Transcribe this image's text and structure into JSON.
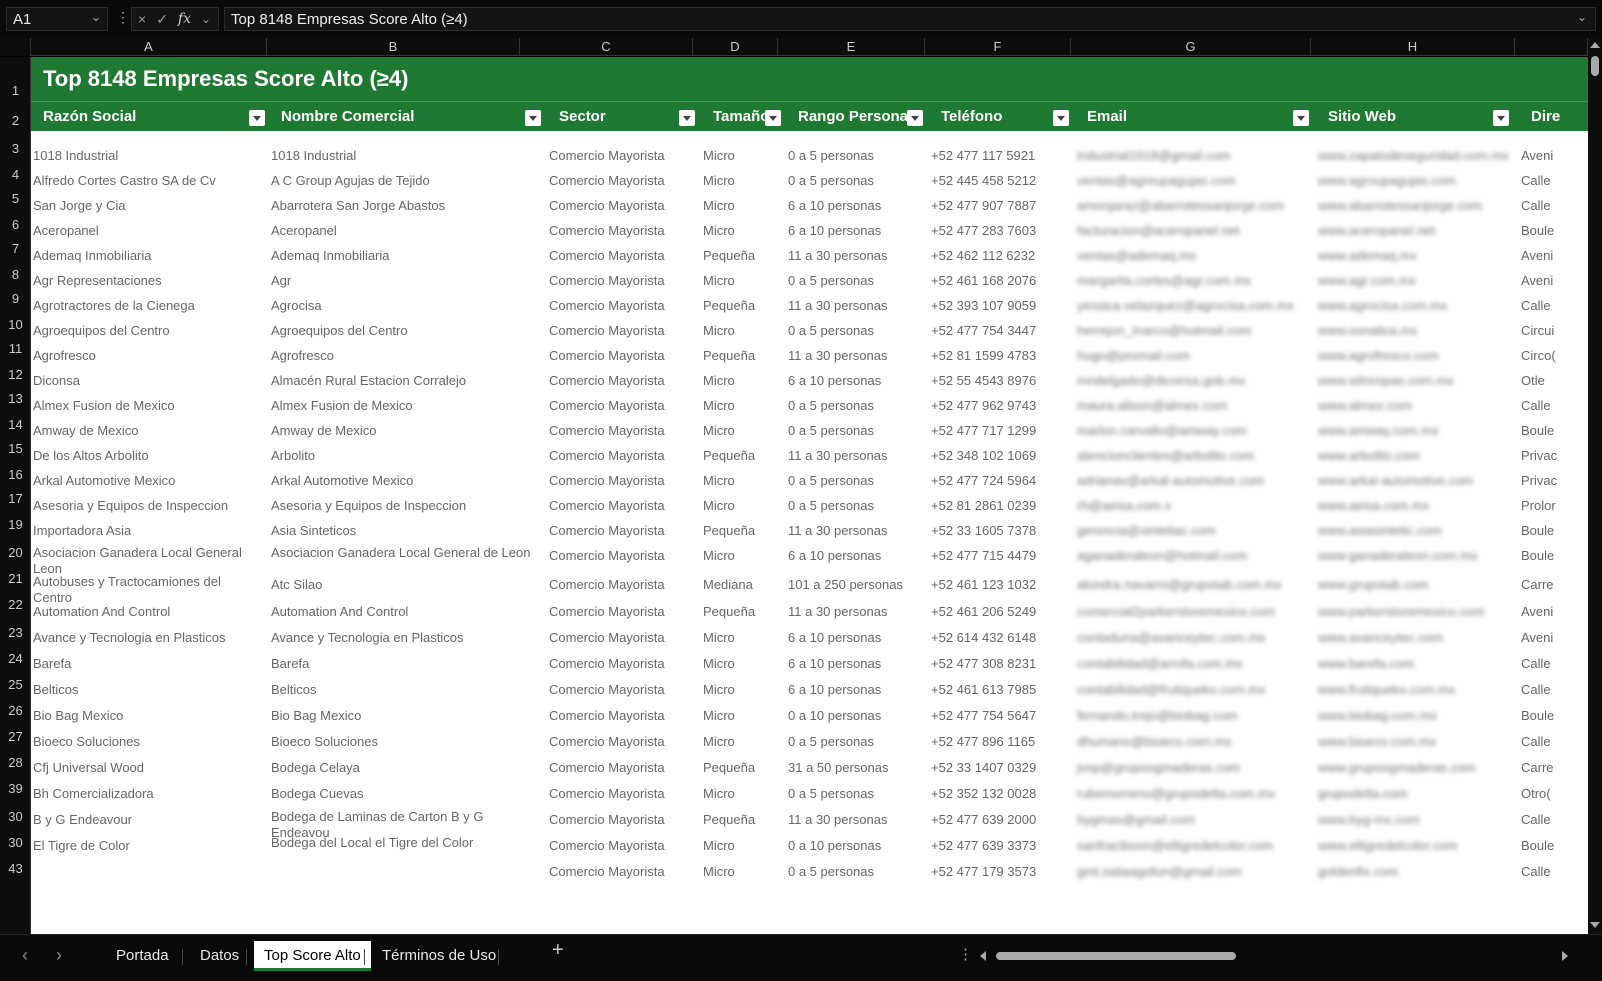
{
  "formula_bar": {
    "cell_ref": "A1",
    "cancel_icon": "×",
    "enter_icon": "✓",
    "fx_label": "fx",
    "formula": "Top 8148 Empresas Score Alto (≥4)"
  },
  "columns": [
    "A",
    "B",
    "C",
    "D",
    "E",
    "F",
    "G",
    "H"
  ],
  "row_numbers": [
    "1",
    "2",
    "3",
    "4",
    "5",
    "6",
    "7",
    "8",
    "9",
    "10",
    "11",
    "12",
    "13",
    "14",
    "15",
    "16",
    "17",
    "19",
    "20",
    "21",
    "22",
    "23",
    "24",
    "25",
    "26",
    "27",
    "28",
    "39",
    "30",
    "30",
    "43"
  ],
  "sheet": {
    "title": "Top 8148 Empresas Score Alto (≥4)",
    "headers": [
      "Razón Social",
      "Nombre Comercial",
      "Sector",
      "Tamaño",
      "Rango Personal",
      "Teléfono",
      "Email",
      "Sitio Web",
      "Dire"
    ],
    "rows": [
      [
        "1018 Industrial",
        "1018 Industrial",
        "Comercio Mayorista",
        "Micro",
        "0 a 5 personas",
        "+52 477 117 5921",
        "industrial1018@gmail.com",
        "www.zapatodeseguridad.com.mx",
        "Aveni"
      ],
      [
        "Alfredo Cortes Castro SA de Cv",
        "A C Group Agujas de Tejido",
        "Comercio Mayorista",
        "Micro",
        "0 a 5 personas",
        "+52 445 458 5212",
        "ventas@agroupagujas.com",
        "www.agroupagujas.com",
        "Calle"
      ],
      [
        "San Jorge y Cia",
        "Abarrotera San Jorge Abastos",
        "Comercio Mayorista",
        "Micro",
        "6 a 10 personas",
        "+52 477 907 7887",
        "amonjaraz@abarrotessanjorge.com",
        "www.abarrotessanjorge.com",
        "Calle"
      ],
      [
        "Aceropanel",
        "Aceropanel",
        "Comercio Mayorista",
        "Micro",
        "6 a 10 personas",
        "+52 477 283 7603",
        "facturacion@aceropanel.net",
        "www.aceropanel.net",
        "Boule"
      ],
      [
        "Ademaq Inmobiliaria",
        "Ademaq Inmobiliaria",
        "Comercio Mayorista",
        "Pequeña",
        "11 a 30 personas",
        "+52 462 112 6232",
        "ventas@ademaq.mx",
        "www.ademaq.mx",
        "Aveni"
      ],
      [
        "Agr Representaciones",
        "Agr",
        "Comercio Mayorista",
        "Micro",
        "0 a 5 personas",
        "+52 461 168 2076",
        "margarita.cortes@agr.com.mx",
        "www.agr.com.mx",
        "Aveni"
      ],
      [
        "Agrotractores de la Cienega",
        "Agrocisa",
        "Comercio Mayorista",
        "Pequeña",
        "11 a 30 personas",
        "+52 393 107 9059",
        "yessica.velazquez@agrocisa.com.mx",
        "www.agrocisa.com.mx",
        "Calle"
      ],
      [
        "Agroequipos del Centro",
        "Agroequipos del Centro",
        "Comercio Mayorista",
        "Micro",
        "0 a 5 personas",
        "+52 477 754 3447",
        "herrejon_marco@hotmail.com",
        "www.sonalica.mx",
        "Circui"
      ],
      [
        "Agrofresco",
        "Agrofresco",
        "Comercio Mayorista",
        "Pequeña",
        "11 a 30 personas",
        "+52 81 1599 4783",
        "hugo@promail.com",
        "www.agrofresco.com",
        "Circo("
      ],
      [
        "Diconsa",
        "Almacén Rural Estacion Corralejo",
        "Comercio Mayorista",
        "Micro",
        "6 a 10 personas",
        "+52 55 4543 8976",
        "mndelgado@diconsa.gob.mx",
        "www.wlmropas.com.mx",
        "Otle"
      ],
      [
        "Almex Fusion de Mexico",
        "Almex Fusion de Mexico",
        "Comercio Mayorista",
        "Micro",
        "0 a 5 personas",
        "+52 477 962 9743",
        "maura.alison@almex.com",
        "www.almex.com",
        "Calle"
      ],
      [
        "Amway de Mexico",
        "Amway de Mexico",
        "Comercio Mayorista",
        "Micro",
        "0 a 5 personas",
        "+52 477 717 1299",
        "marlon.carvallo@amway.com",
        "www.amway.com.mx",
        "Boule"
      ],
      [
        "De los Altos Arbolito",
        "Arbolito",
        "Comercio Mayorista",
        "Pequeña",
        "11 a 30 personas",
        "+52 348 102 1069",
        "atencionclientes@arbolito.com",
        "www.arbolito.com",
        "Privac"
      ],
      [
        "Arkal Automotive Mexico",
        "Arkal Automotive Mexico",
        "Comercio Mayorista",
        "Micro",
        "0 a 5 personas",
        "+52 477 724 5964",
        "adrianav@arkal-automotive.com",
        "www.arkal-automotive.com",
        "Privac"
      ],
      [
        "Asesoria y Equipos de Inspeccion",
        "Asesoria y Equipos de Inspeccion",
        "Comercio Mayorista",
        "Micro",
        "0 a 5 personas",
        "+52 81 2861 0239",
        "rh@aeisa.com.x",
        "www.aeisa.com.mx",
        "Prolor"
      ],
      [
        "Importadora Asia",
        "Asia Sinteticos",
        "Comercio Mayorista",
        "Pequeña",
        "11 a 30 personas",
        "+52 33 1605 7378",
        "gerencia@sintetiac.com",
        "www.asiasintetic.com",
        "Boule"
      ],
      [
        "Asociacion Ganadera Local General Leon",
        "Asociacion Ganadera Local General de Leon",
        "Comercio Mayorista",
        "Micro",
        "6 a 10 personas",
        "+52 477 715 4479",
        "aganaderaleon@hotmail.com",
        "www.ganaderaleon.com.mx",
        "Boule"
      ],
      [
        "Autobuses y Tractocamiones del Centro",
        "Atc Silao",
        "Comercio Mayorista",
        "Mediana",
        "101 a 250 personas",
        "+52 461 123 1032",
        "alondra.navarro@grupotab.com.mx",
        "www.grupotab.com",
        "Carre"
      ],
      [
        "Automation And Control",
        "Automation And Control",
        "Comercio Mayorista",
        "Pequeña",
        "11 a 30 personas",
        "+52 461 206 5249",
        "comercial2parkerstoremexico.com",
        "www.parkerstoremexico.com",
        "Aveni"
      ],
      [
        "Avance y Tecnologia en Plasticos",
        "Avance y Tecnologia en Plasticos",
        "Comercio Mayorista",
        "Micro",
        "6 a 10 personas",
        "+52 614 432 6148",
        "contaduria@avanceytec.com.mx",
        "www.avanceytec.com",
        "Aveni"
      ],
      [
        "Barefa",
        "Barefa",
        "Comercio Mayorista",
        "Micro",
        "6 a 10 personas",
        "+52 477 308 8231",
        "contabilidad@arrofa.com.mx",
        "www.barefa.com",
        "Calle"
      ],
      [
        "Belticos",
        "Belticos",
        "Comercio Mayorista",
        "Micro",
        "6 a 10 personas",
        "+52 461 613 7985",
        "contabilidad@frutiqueko.com.mx",
        "www.frutiqueko.com.mx",
        "Calle"
      ],
      [
        "Bio Bag Mexico",
        "Bio Bag Mexico",
        "Comercio Mayorista",
        "Micro",
        "0 a 10 personas",
        "+52 477 754 5647",
        "fernando.trejo@biobag.com",
        "www.biobag.com.mx",
        "Boule"
      ],
      [
        "Bioeco Soluciones",
        "Bioeco Soluciones",
        "Comercio Mayorista",
        "Micro",
        "0 a 5 personas",
        "+52 477 896 1165",
        "dhumano@bioeco.com.mx",
        "www.bioeco.com.mx",
        "Calle"
      ],
      [
        "Cfj Universal Wood",
        "Bodega Celaya",
        "Comercio Mayorista",
        "Pequeña",
        "31 a 50 personas",
        "+52 33 1407 0329",
        "jvop@grupoogmaderas.com",
        "www.grupoogmaderas.com",
        "Carre"
      ],
      [
        "Bh Comercializadora",
        "Bodega Cuevas",
        "Comercio Mayorista",
        "Micro",
        "0 a 5 personas",
        "+52 352 132 0028",
        "rubemorreno@grupodelta.com.mx",
        "grupodelta.com",
        "Otro("
      ],
      [
        "B y G Endeavour",
        "Bodega de Laminas de Carton B y G Endeavou",
        "Comercio Mayorista",
        "Pequeña",
        "11 a 30 personas",
        "+52 477 639 2000",
        "bygmas@gmail.com",
        "www.byg-mx.com",
        "Calle"
      ],
      [
        "El Tigre de Color",
        "Bodega del Local el Tigre del Color",
        "Comercio Mayorista",
        "Micro",
        "0 a 10 personas",
        "+52 477 639 3373",
        "sanfraciboon@eltigredelcolor.com",
        "www.eltigredelcolor.com",
        "Boule"
      ],
      [
        "",
        "",
        "Comercio Mayorista",
        "Micro",
        "0 a 5 personas",
        "+52 477 179 3573",
        "gmt.satiaagofun@gmail.com",
        "goldenfix.com",
        "Calle"
      ]
    ]
  },
  "tabs": [
    "Portada",
    "Datos",
    "Top Score Alto",
    "Términos de Uso"
  ],
  "active_tab": "Top Score Alto",
  "colors": {
    "header_green": "#1e7a32",
    "grid_bg": "#ffffff",
    "chrome_bg": "#0a0a0a"
  }
}
